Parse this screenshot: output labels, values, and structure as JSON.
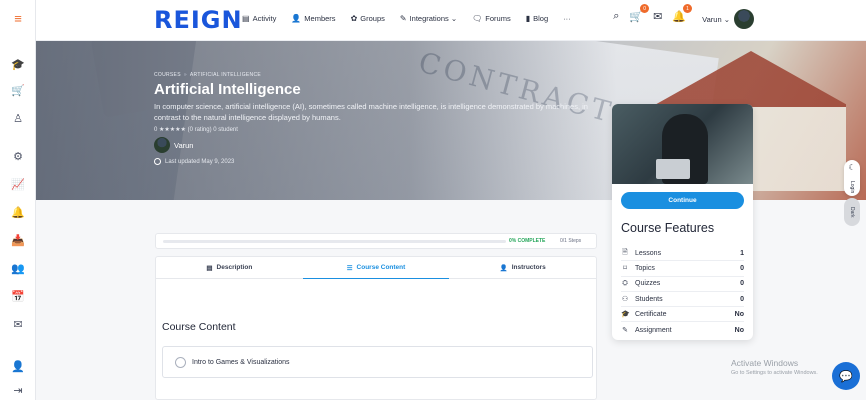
{
  "brand": {
    "logo": "REIGN"
  },
  "nav": [
    {
      "icon": "activity-icon",
      "glyph": "▤",
      "label": "Activity"
    },
    {
      "icon": "members-icon",
      "glyph": "👤",
      "label": "Members"
    },
    {
      "icon": "groups-icon",
      "glyph": "✿",
      "label": "Groups"
    },
    {
      "icon": "integrations-icon",
      "glyph": "✎",
      "label": "Integrations ⌄"
    },
    {
      "icon": "forums-icon",
      "glyph": "🗨",
      "label": "Forums"
    },
    {
      "icon": "blog-icon",
      "glyph": "▮",
      "label": "Blog"
    },
    {
      "icon": "more-icon",
      "glyph": "",
      "label": "···"
    }
  ],
  "header_right": {
    "cart_count": "0",
    "notif_count": "1",
    "username": "Varun ⌄"
  },
  "hero": {
    "breadcrumb": [
      "COURSES",
      "ARTIFICIAL INTELLIGENCE"
    ],
    "breadcrumb_sep": "»",
    "title": "Artificial Intelligence",
    "description": "In computer science, artificial intelligence (AI), sometimes called machine intelligence, is intelligence demonstrated by machines, in contrast to the natural intelligence displayed by humans.",
    "rating": "0 ★★★★★ (0 rating) 0 student",
    "author": "Varun",
    "updated": "Last updated May 9, 2023"
  },
  "course_card": {
    "continue_label": "Continue",
    "features_title": "Course Features",
    "features": [
      {
        "icon": "lessons-icon",
        "glyph": "🗎",
        "label": "Lessons",
        "value": "1"
      },
      {
        "icon": "topics-icon",
        "glyph": "⌑",
        "label": "Topics",
        "value": "0"
      },
      {
        "icon": "quizzes-icon",
        "glyph": "⛭",
        "label": "Quizzes",
        "value": "0"
      },
      {
        "icon": "students-icon",
        "glyph": "⚇",
        "label": "Students",
        "value": "0"
      },
      {
        "icon": "certificate-icon",
        "glyph": "🎓",
        "label": "Certificate",
        "value": "No"
      },
      {
        "icon": "assignment-icon",
        "glyph": "✎",
        "label": "Assignment",
        "value": "No"
      }
    ]
  },
  "progress": {
    "percent": 0,
    "label": "0% COMPLETE",
    "steps": "0/1 Steps"
  },
  "tabs": [
    {
      "icon": "description-icon",
      "glyph": "▤",
      "label": "Description",
      "active": false
    },
    {
      "icon": "course-content-icon",
      "glyph": "☰",
      "label": "Course Content",
      "active": true
    },
    {
      "icon": "instructors-icon",
      "glyph": "👤",
      "label": "Instructors",
      "active": false
    }
  ],
  "content": {
    "title": "Course Content",
    "lessons": [
      "Intro to Games & Visualizations"
    ]
  },
  "side_widgets": {
    "login_label": "Login",
    "dark_label": "Dark"
  },
  "watermark": {
    "line1": "Activate Windows",
    "line2": "Go to Settings to activate Windows."
  },
  "colors": {
    "accent": "#1a8fe0",
    "brand": "#1a56db",
    "badge": "#ef6b2b",
    "complete": "#26a65b"
  }
}
